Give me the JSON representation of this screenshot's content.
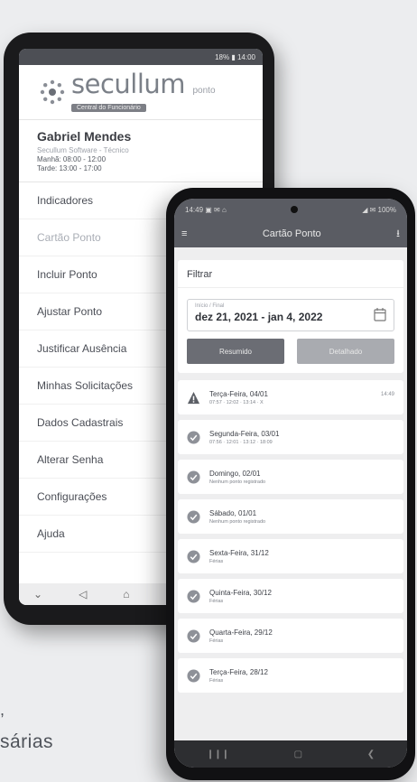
{
  "back_app": {
    "status_text": "18% ▮ 14:00",
    "brand": {
      "name": "secullum",
      "product": "ponto",
      "subtitle": "Central do Funcionário"
    },
    "user": {
      "name": "Gabriel Mendes",
      "company": "Secullum Software - Técnico",
      "morning": "Manhã: 08:00 - 12:00",
      "afternoon": "Tarde: 13:00 - 17:00"
    },
    "menu": [
      {
        "label": "Indicadores"
      },
      {
        "label": "Cartão Ponto"
      },
      {
        "label": "Incluir Ponto"
      },
      {
        "label": "Ajustar Ponto"
      },
      {
        "label": "Justificar Ausência"
      },
      {
        "label": "Minhas Solicitações"
      },
      {
        "label": "Dados Cadastrais"
      },
      {
        "label": "Alterar Senha"
      },
      {
        "label": "Configurações"
      },
      {
        "label": "Ajuda"
      }
    ],
    "nav": {
      "down": "⌄",
      "back": "◁",
      "home": "⌂"
    }
  },
  "caption": {
    "comma": ",",
    "text": "sárias"
  },
  "front_app": {
    "status_left": "14:49 ▣ ✉ ⌂",
    "status_right": "◢ ✉ 100%",
    "title": "Cartão Ponto",
    "menu_icon": "≡",
    "action_icon": "⭳",
    "filter": {
      "title": "Filtrar",
      "period_label": "Início / Final",
      "period_value": "dez 21, 2021 - jan 4, 2022",
      "btn_summary": "Resumido",
      "btn_detailed": "Detalhado"
    },
    "days": [
      {
        "day": "Terça-Feira, 04/01",
        "sub": "07:57 · 12:02 · 13:14 · X",
        "right": "14:49",
        "status": "warning"
      },
      {
        "day": "Segunda-Feira, 03/01",
        "sub": "07:56 · 12:01 · 13:12 · 18:09",
        "right": "",
        "status": "ok"
      },
      {
        "day": "Domingo, 02/01",
        "sub": "Nenhum ponto registrado",
        "right": "",
        "status": "ok"
      },
      {
        "day": "Sábado, 01/01",
        "sub": "Nenhum ponto registrado",
        "right": "",
        "status": "ok"
      },
      {
        "day": "Sexta-Feira, 31/12",
        "sub": "Férias",
        "right": "",
        "status": "ok"
      },
      {
        "day": "Quinta-Feira, 30/12",
        "sub": "Férias",
        "right": "",
        "status": "ok"
      },
      {
        "day": "Quarta-Feira, 29/12",
        "sub": "Férias",
        "right": "",
        "status": "ok"
      },
      {
        "day": "Terça-Feira, 28/12",
        "sub": "Férias",
        "right": "",
        "status": "ok"
      }
    ],
    "nav": {
      "recent": "❙❙❙",
      "home": "▢",
      "back": "❮"
    }
  },
  "colors": {
    "bar": "#5a5c63",
    "ok_icon": "#8e9198",
    "warn_icon": "#5c5f66"
  }
}
